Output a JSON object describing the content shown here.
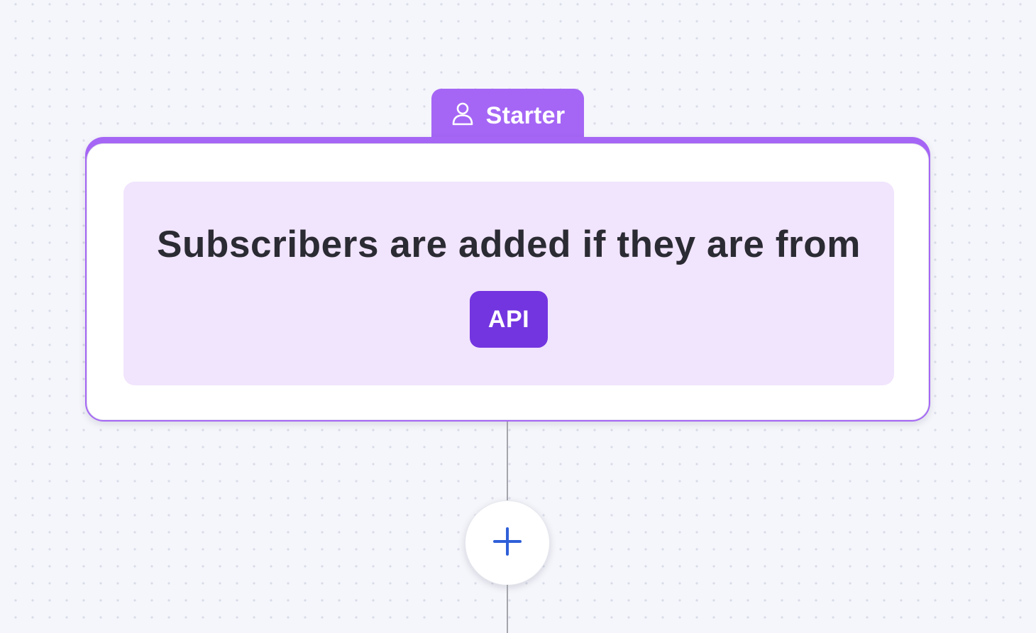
{
  "starter": {
    "label": "Starter",
    "icon": "user-icon"
  },
  "rule": {
    "text": "Subscribers are added if they are from",
    "source": "API"
  },
  "add_step": {
    "icon": "plus-icon"
  },
  "colors": {
    "accent": "#a566f5",
    "chip": "#7335e0",
    "rule_background": "#f1e4fd",
    "plus": "#2f5fd8",
    "canvas": "#f5f6fb"
  }
}
